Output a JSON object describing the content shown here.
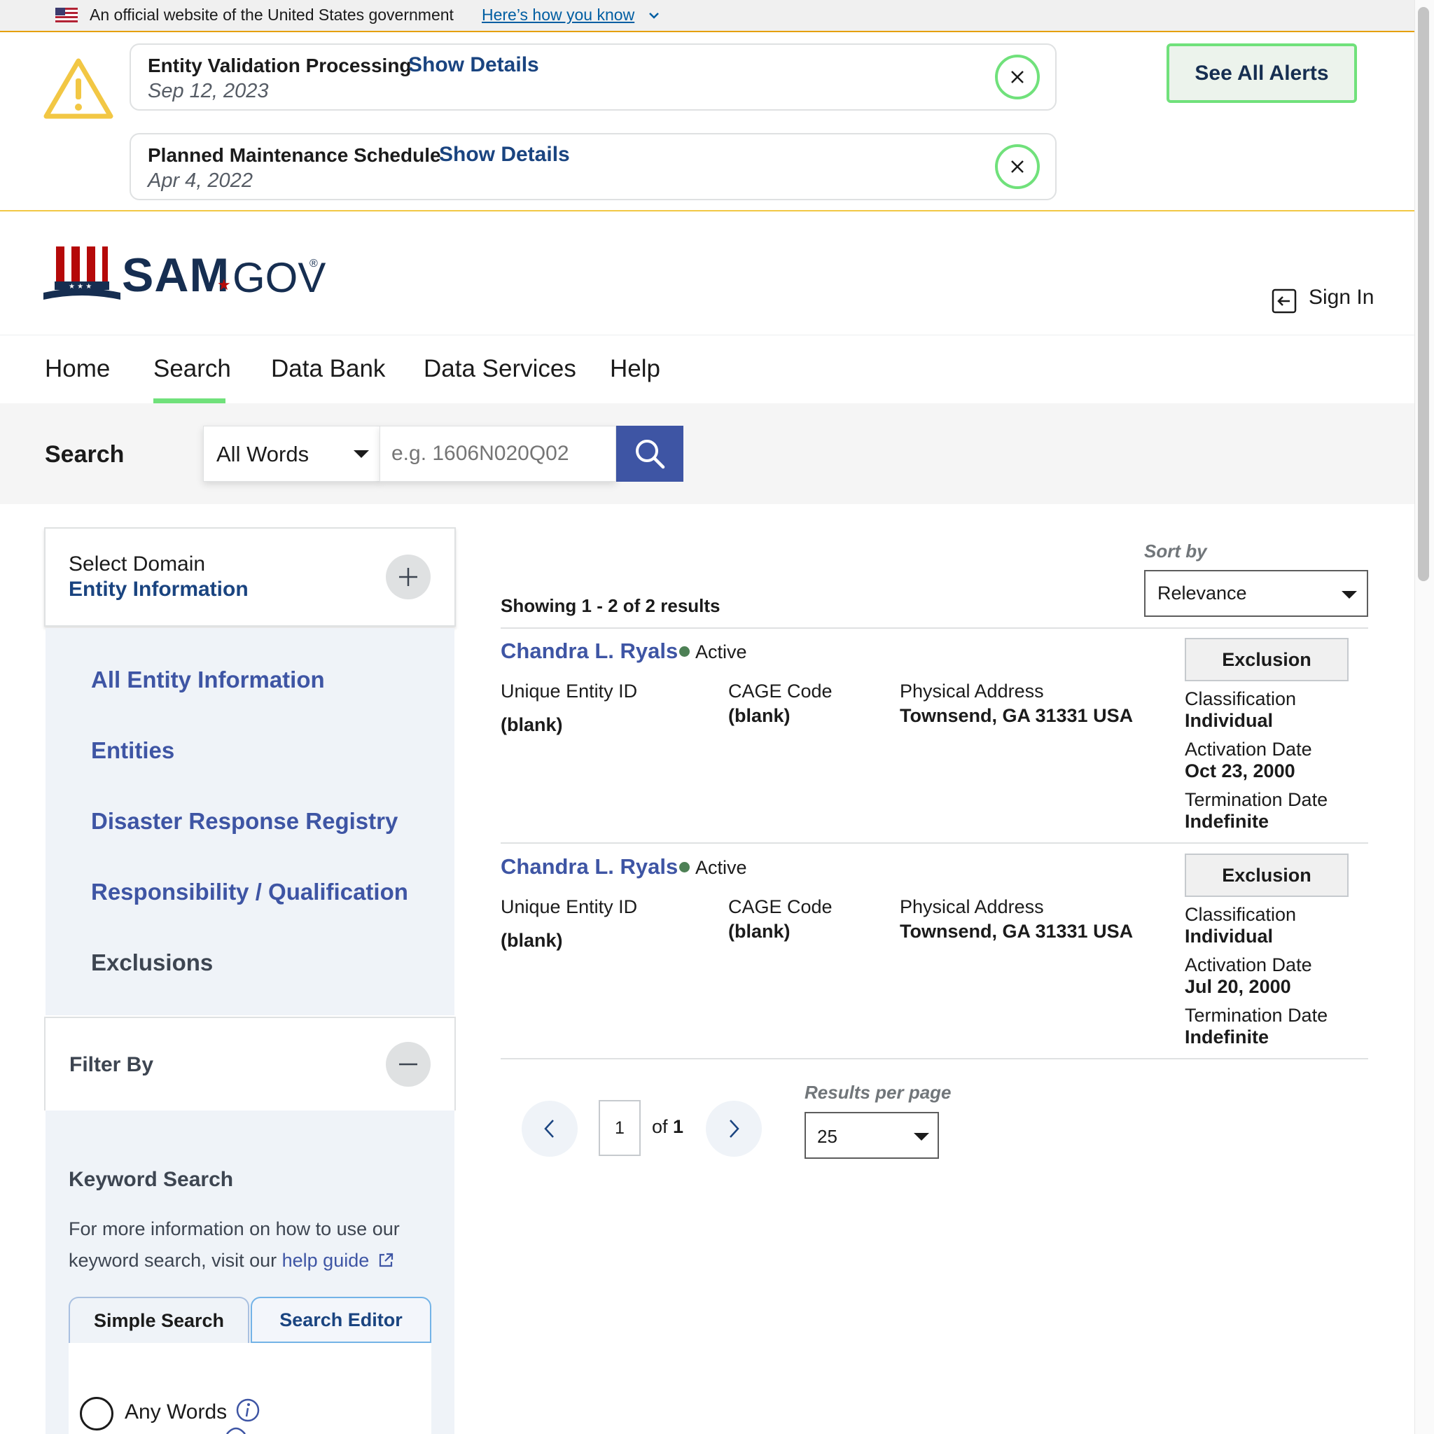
{
  "gov_banner": {
    "text": "An official website of the United States government",
    "link": "Here’s how you know"
  },
  "alerts": [
    {
      "title": "Entity Validation Processing",
      "link": "Show Details",
      "date": "Sep 12, 2023"
    },
    {
      "title": "Planned Maintenance Schedule",
      "link": "Show Details",
      "date": "Apr 4, 2022"
    }
  ],
  "see_all_alerts": "See All Alerts",
  "header": {
    "logo_main": "SAM",
    "logo_suffix": "GOV",
    "logo_mark": "®",
    "sign_in": "Sign In"
  },
  "nav": {
    "items": [
      "Home",
      "Search",
      "Data Bank",
      "Data Services",
      "Help"
    ],
    "active": "Search"
  },
  "search": {
    "label": "Search",
    "mode": "All Words",
    "placeholder": "e.g. 1606N020Q02"
  },
  "sidebar": {
    "domain_caption": "Select Domain",
    "domain_value": "Entity Information",
    "domains": [
      "All Entity Information",
      "Entities",
      "Disaster Response Registry",
      "Responsibility / Qualification",
      "Exclusions"
    ],
    "current_domain": "Exclusions",
    "filter_title": "Filter By",
    "keyword_title": "Keyword Search",
    "keyword_text": "For more information on how to use our keyword search, visit our",
    "keyword_link": "help guide",
    "tabs": [
      "Simple Search",
      "Search Editor"
    ],
    "radio_label": "Any Words"
  },
  "results": {
    "sort_label": "Sort by",
    "sort_value": "Relevance",
    "showing": "Showing 1 - 2 of 2 results",
    "labels": {
      "uei": "Unique Entity ID",
      "cage": "CAGE Code",
      "address": "Physical Address",
      "classification": "Classification",
      "activation": "Activation Date",
      "termination": "Termination Date"
    },
    "items": [
      {
        "name": "Chandra L. Ryals",
        "status": "Active",
        "uei": "(blank)",
        "cage": "(blank)",
        "address": "Townsend, GA 31331 USA",
        "type_button": "Exclusion",
        "classification": "Individual",
        "activation": "Oct 23, 2000",
        "termination": "Indefinite"
      },
      {
        "name": "Chandra L. Ryals",
        "status": "Active",
        "uei": "(blank)",
        "cage": "(blank)",
        "address": "Townsend, GA 31331 USA",
        "type_button": "Exclusion",
        "classification": "Individual",
        "activation": "Jul 20, 2000",
        "termination": "Indefinite"
      }
    ]
  },
  "pagination": {
    "current_page": "1",
    "of_text": "of",
    "total_pages": "1",
    "rpp_label": "Results per page",
    "rpp_value": "25"
  },
  "colors": {
    "accent_green": "#70e17b",
    "link_blue": "#3e55a4",
    "navy": "#1a4480",
    "alert_yellow": "#f2c744",
    "status_green": "#4d8055"
  }
}
